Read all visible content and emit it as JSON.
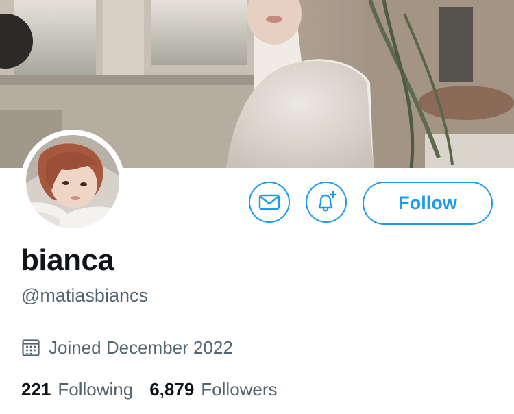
{
  "profile": {
    "display_name": "bianca",
    "handle": "@matiasbiancs",
    "joined": "Joined December 2022"
  },
  "actions": {
    "message_icon": "envelope-icon",
    "notify_icon": "bell-plus-icon",
    "follow_label": "Follow"
  },
  "stats": {
    "following_count": "221",
    "following_label": "Following",
    "followers_count": "6,879",
    "followers_label": "Followers"
  },
  "colors": {
    "accent": "#1d9bf0",
    "text_primary": "#0f1419",
    "text_secondary": "#536471"
  }
}
